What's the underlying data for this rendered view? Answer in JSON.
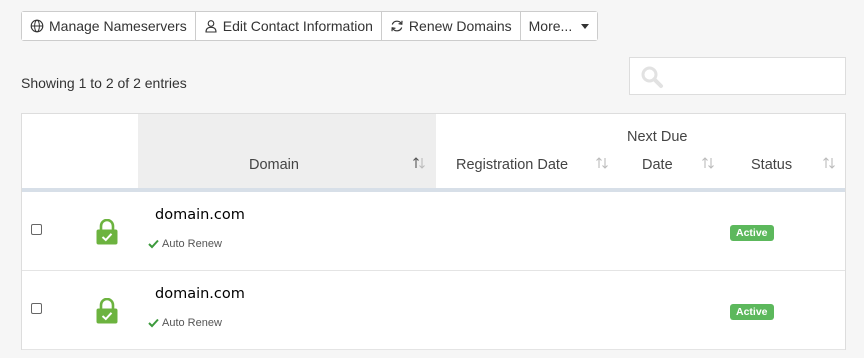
{
  "toolbar": {
    "manage_ns": "Manage Nameservers",
    "edit_contact": "Edit Contact Information",
    "renew": "Renew Domains",
    "more": "More..."
  },
  "showing_text": "Showing 1 to 2 of 2 entries",
  "table": {
    "headers": {
      "domain": "Domain",
      "reg_date": "Registration Date",
      "next_due_1": "Next Due",
      "next_due_2": "Date",
      "status": "Status"
    },
    "rows": [
      {
        "domain": "domain.com",
        "auto_renew": "Auto Renew",
        "reg_date": "",
        "next_due": "",
        "status": "Active"
      },
      {
        "domain": "domain.com",
        "auto_renew": "Auto Renew",
        "reg_date": "",
        "next_due": "",
        "status": "Active"
      }
    ]
  },
  "colors": {
    "active_badge": "#5cb85c",
    "lock_green": "#6cb33f",
    "check_green": "#3c9a3c"
  }
}
